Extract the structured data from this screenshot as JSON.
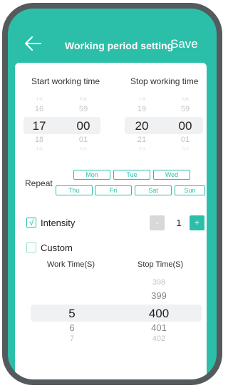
{
  "header": {
    "title": "Working period setting",
    "save_label": "Save",
    "back_icon": "arrow-left-icon"
  },
  "start": {
    "label": "Start working time",
    "hours": [
      "15",
      "16",
      "17",
      "18",
      "19"
    ],
    "minutes": [
      "58",
      "59",
      "00",
      "01",
      "02"
    ]
  },
  "stop": {
    "label": "Stop working time",
    "hours": [
      "18",
      "19",
      "20",
      "21",
      "22"
    ],
    "minutes": [
      "58",
      "59",
      "00",
      "01",
      "02"
    ]
  },
  "repeat": {
    "label": "Repeat",
    "days_row1": [
      "Mon",
      "Tue",
      "Wed"
    ],
    "days_row2": [
      "Thu",
      "Fri",
      "Sat",
      "Sun"
    ]
  },
  "intensity": {
    "label": "Intensity",
    "checked": true,
    "check_mark": "√",
    "value": "1",
    "minus_label": "-",
    "plus_label": "+"
  },
  "custom": {
    "label": "Custom",
    "checked": false,
    "work_time_label": "Work Time(S)",
    "stop_time_label": "Stop Time(S)",
    "work_values": [
      "5",
      "6",
      "7"
    ],
    "stop_values": [
      "398",
      "399",
      "400",
      "401",
      "402"
    ]
  },
  "colors": {
    "accent": "#2bbfa9",
    "frame": "#555a5c",
    "highlight": "#f0f1f2"
  }
}
